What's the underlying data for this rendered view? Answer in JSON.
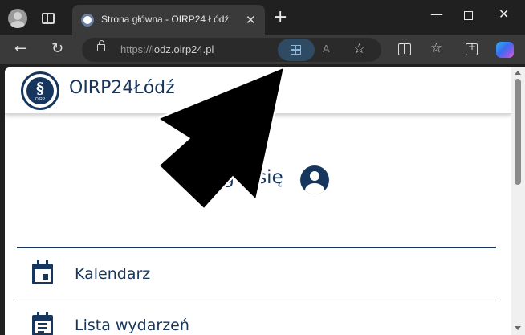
{
  "browser": {
    "tab": {
      "title": "Strona główna - OIRP24 Łódź",
      "favicon": "oirp-seal-icon"
    },
    "address_bar": {
      "scheme": "https://",
      "host": "lodz.oirp24.pl"
    },
    "icons": {
      "profile": "profile-icon",
      "tab_actions": "tab-actions-icon",
      "close_tab": "close-icon",
      "new_tab": "plus-icon",
      "back": "back-arrow-icon",
      "reload": "reload-icon",
      "app_view": "app-view-icon",
      "read_aloud": "read-aloud-icon",
      "favorite": "star-icon",
      "split_screen": "split-screen-icon",
      "favorites": "favorites-list-icon",
      "collections": "collections-icon",
      "copilot": "copilot-icon"
    },
    "glyphs": {
      "close": "✕",
      "new_tab": "+",
      "back": "←",
      "reload": "↻",
      "read_aloud": "A",
      "favorite": "☆",
      "favorites": "☆",
      "minimize": "—",
      "window_close": "✕"
    }
  },
  "site": {
    "brand": "OIRP24Łódź",
    "logo_glyph": "§",
    "logo_text": "OIRP",
    "login": "Zaloguj się",
    "menu": [
      {
        "label": "Kalendarz",
        "icon": "calendar-icon"
      },
      {
        "label": "Lista wydarzeń",
        "icon": "event-list-icon"
      }
    ]
  },
  "colors": {
    "brand_navy": "#17365d",
    "chrome_dark": "#202020",
    "toolbar": "#3a3a3a",
    "app_view_highlight": "#2f4b63"
  }
}
